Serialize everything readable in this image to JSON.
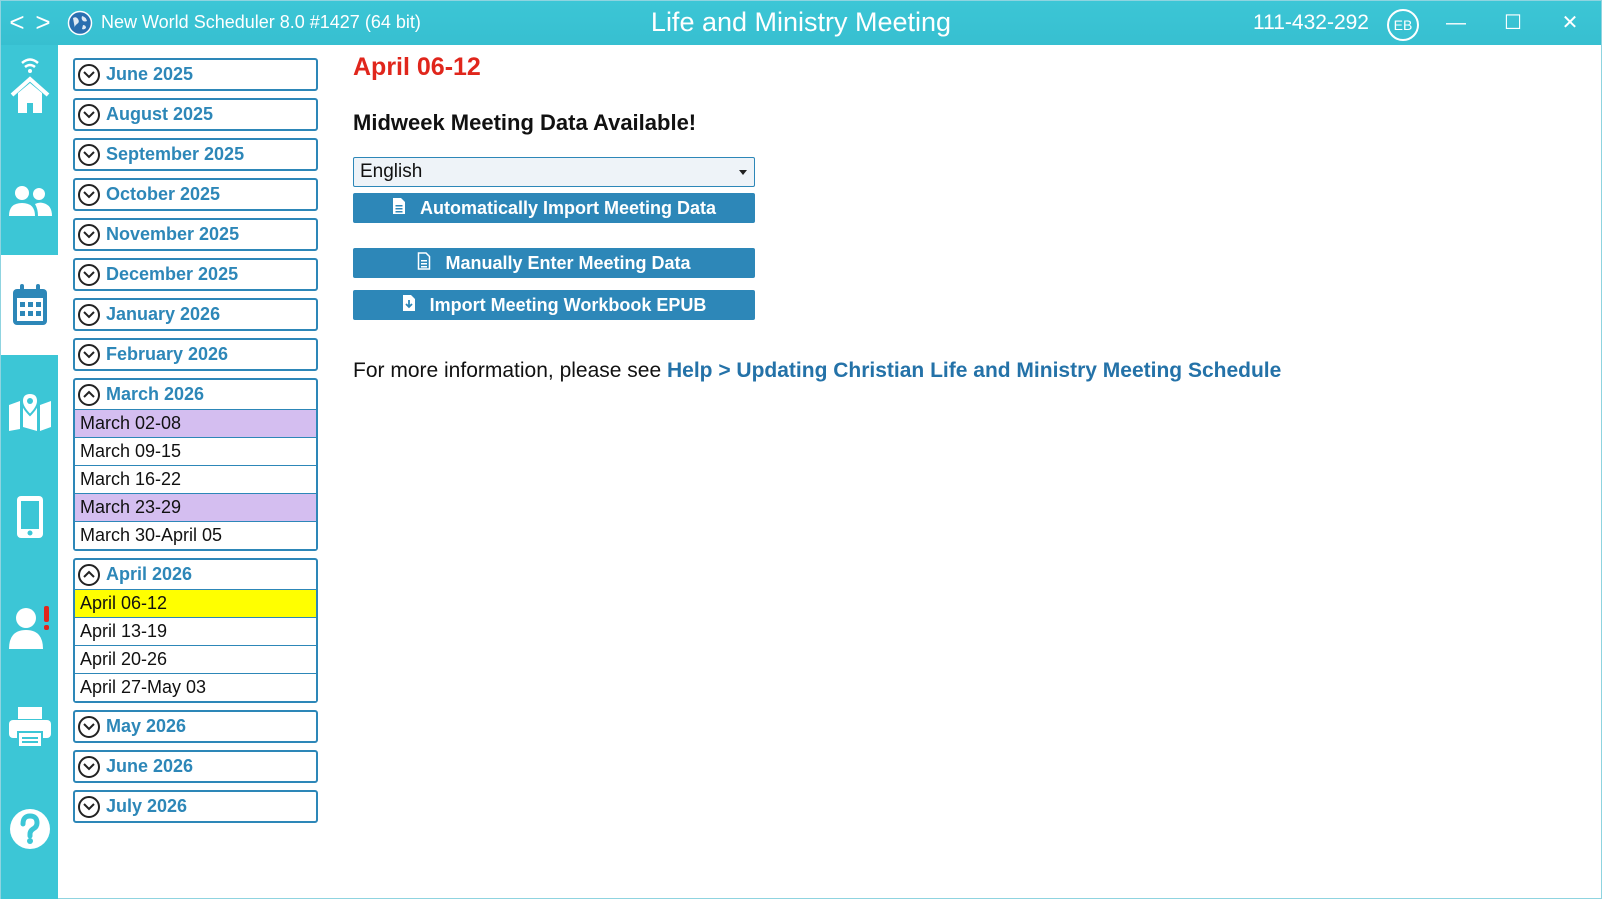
{
  "titlebar": {
    "app_title": "New World Scheduler 8.0 #1427 (64 bit)",
    "center_title": "Life and Ministry Meeting",
    "id_code": "111-432-292",
    "user_initials": "EB",
    "back_glyph": "<",
    "forward_glyph": ">",
    "min_glyph": "—",
    "max_glyph": "☐",
    "close_glyph": "✕"
  },
  "rail": {
    "items": [
      {
        "name": "home-icon"
      },
      {
        "name": "people-icon"
      },
      {
        "name": "calendar-icon",
        "active": true
      },
      {
        "name": "map-icon"
      },
      {
        "name": "phone-icon"
      },
      {
        "name": "user-alert-icon"
      },
      {
        "name": "printer-icon"
      },
      {
        "name": "help-icon"
      }
    ]
  },
  "months": [
    {
      "label": "June 2025",
      "expanded": false,
      "weeks": []
    },
    {
      "label": "August 2025",
      "expanded": false,
      "weeks": []
    },
    {
      "label": "September 2025",
      "expanded": false,
      "weeks": []
    },
    {
      "label": "October 2025",
      "expanded": false,
      "weeks": []
    },
    {
      "label": "November 2025",
      "expanded": false,
      "weeks": []
    },
    {
      "label": "December 2025",
      "expanded": false,
      "weeks": []
    },
    {
      "label": "January 2026",
      "expanded": false,
      "weeks": []
    },
    {
      "label": "February 2026",
      "expanded": false,
      "weeks": []
    },
    {
      "label": "March 2026",
      "expanded": true,
      "weeks": [
        {
          "label": "March 02-08",
          "highlight": "purple"
        },
        {
          "label": "March 09-15",
          "highlight": ""
        },
        {
          "label": "March 16-22",
          "highlight": ""
        },
        {
          "label": "March 23-29",
          "highlight": "purple"
        },
        {
          "label": "March 30-April 05",
          "highlight": ""
        }
      ]
    },
    {
      "label": "April 2026",
      "expanded": true,
      "weeks": [
        {
          "label": "April 06-12",
          "highlight": "yellow"
        },
        {
          "label": "April 13-19",
          "highlight": ""
        },
        {
          "label": "April 20-26",
          "highlight": ""
        },
        {
          "label": "April 27-May 03",
          "highlight": ""
        }
      ]
    },
    {
      "label": "May 2026",
      "expanded": false,
      "weeks": []
    },
    {
      "label": "June 2026",
      "expanded": false,
      "weeks": []
    },
    {
      "label": "July 2026",
      "expanded": false,
      "weeks": []
    }
  ],
  "main": {
    "week_title": "April 06-12",
    "available_heading": "Midweek Meeting Data Available!",
    "language_selected": "English",
    "auto_import_label": "Automatically Import Meeting Data",
    "manual_label": "Manually Enter Meeting Data",
    "epub_label": "Import Meeting Workbook EPUB",
    "info_prefix": "For more information, please see",
    "info_link": "Help > Updating Christian Life and Ministry Meeting Schedule"
  },
  "colors": {
    "accent_teal": "#3cc6d6",
    "link_blue": "#2d87b8",
    "title_red": "#e0261c",
    "highlight_purple": "#d4bef0",
    "highlight_yellow": "#ffff00"
  }
}
